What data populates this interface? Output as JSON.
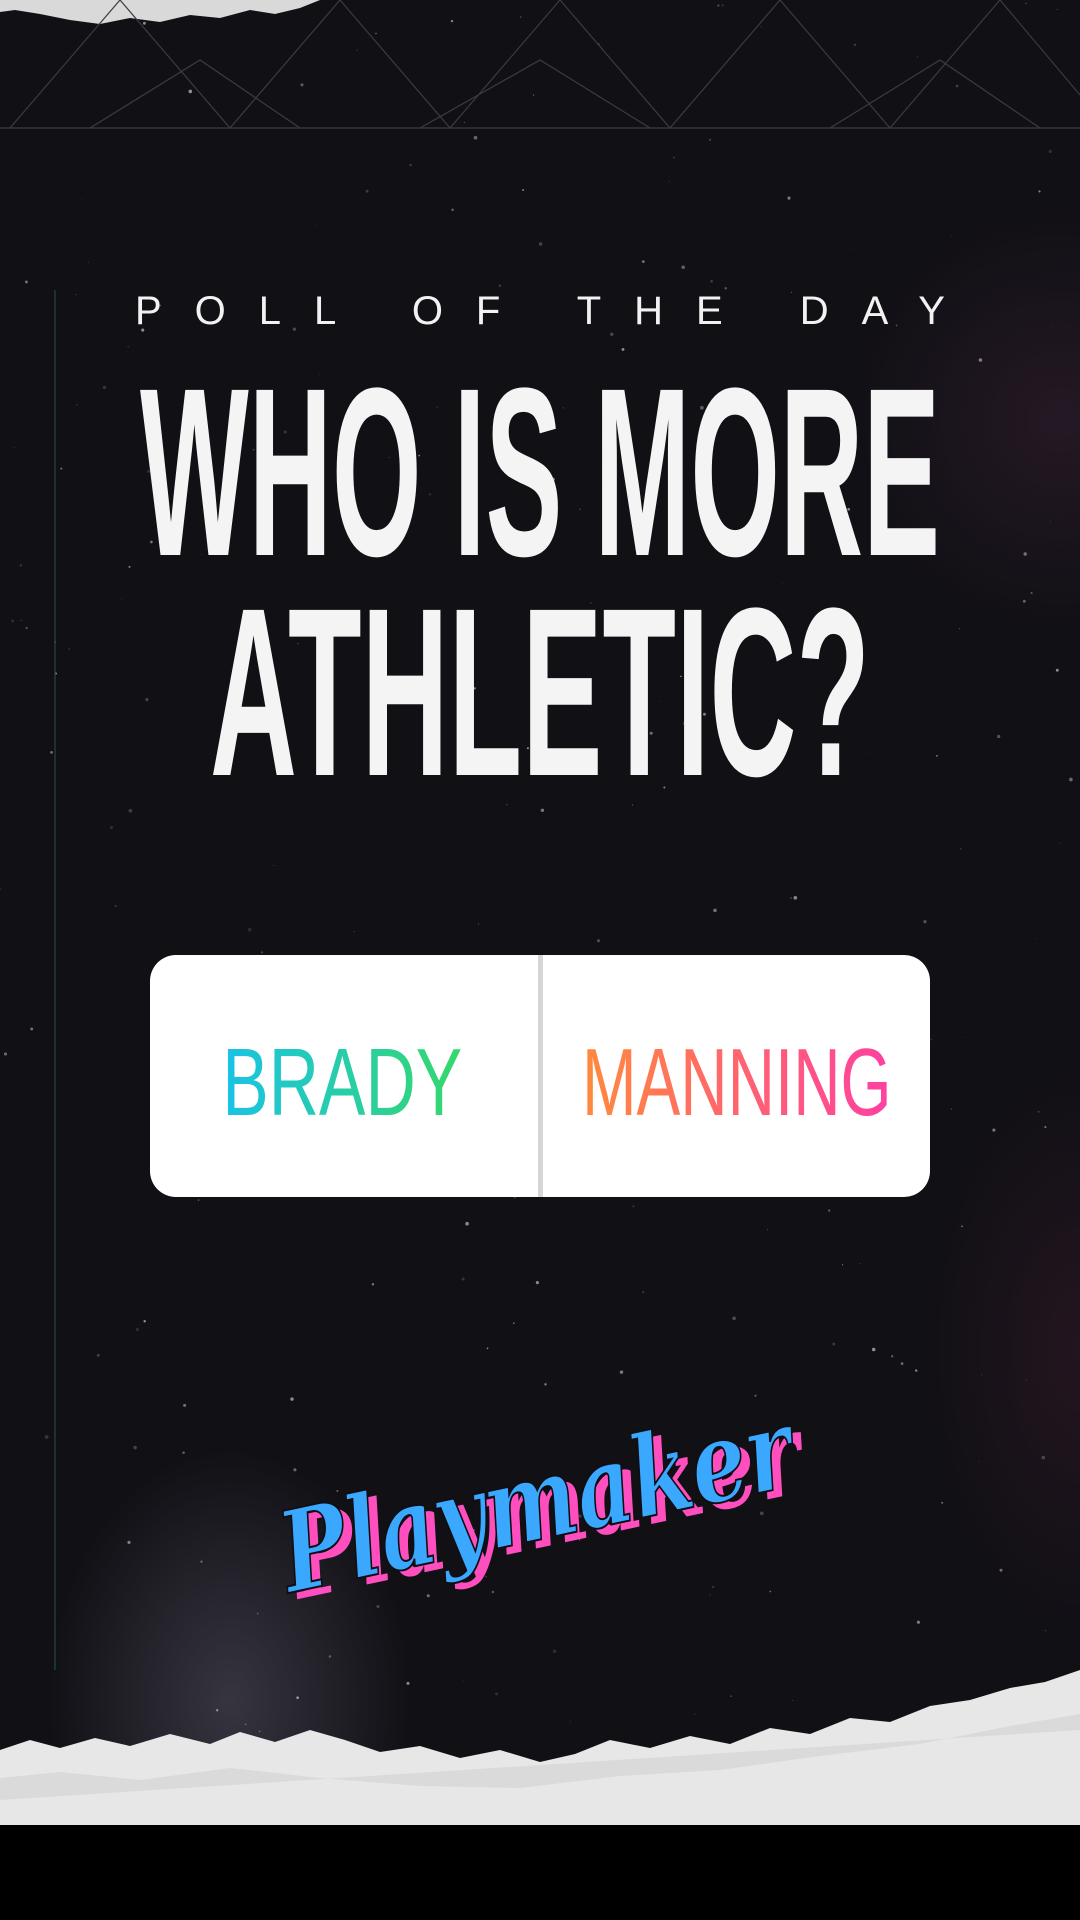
{
  "story": {
    "kicker": "POLL OF THE DAY",
    "headline": {
      "line1": "WHO IS MORE",
      "line2": "ATHLETIC?"
    },
    "poll": {
      "options": [
        {
          "label": "BRADY",
          "gradient": [
            "#19c3e6",
            "#36d86a"
          ]
        },
        {
          "label": "MANNING",
          "gradient": [
            "#ff8a3c",
            "#ff3fa2"
          ]
        }
      ]
    },
    "brand": {
      "logo_text": "Playmaker",
      "colors": {
        "fill": "#3aa8ff",
        "shadow": "#ff4fbf"
      }
    }
  }
}
